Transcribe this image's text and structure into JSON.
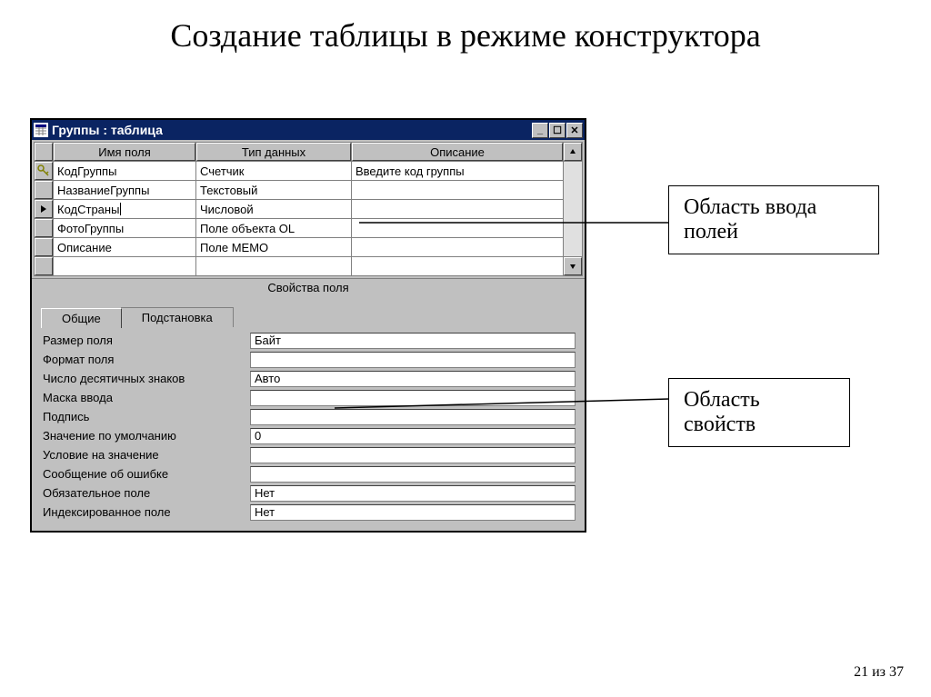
{
  "slide_title": "Создание таблицы в режиме конструктора",
  "window": {
    "title": "Группы : таблица",
    "columns": {
      "name": "Имя поля",
      "type": "Тип данных",
      "desc": "Описание"
    },
    "rows": [
      {
        "name": "КодГруппы",
        "type": "Счетчик",
        "desc": "Введите код группы",
        "icon": "key"
      },
      {
        "name": "НазваниеГруппы",
        "type": "Текстовый",
        "desc": "",
        "icon": ""
      },
      {
        "name": "КодСтраны",
        "type": "Числовой",
        "desc": "",
        "icon": "current"
      },
      {
        "name": "ФотоГруппы",
        "type": "Поле объекта OL",
        "desc": "",
        "icon": ""
      },
      {
        "name": "Описание",
        "type": "Поле МЕМО",
        "desc": "",
        "icon": ""
      }
    ],
    "propbar_label": "Свойства поля",
    "tabs": {
      "general": "Общие",
      "lookup": "Подстановка"
    },
    "properties": [
      {
        "label": "Размер поля",
        "value": "Байт"
      },
      {
        "label": "Формат поля",
        "value": ""
      },
      {
        "label": "Число десятичных знаков",
        "value": "Авто"
      },
      {
        "label": "Маска ввода",
        "value": ""
      },
      {
        "label": "Подпись",
        "value": ""
      },
      {
        "label": "Значение по умолчанию",
        "value": "0"
      },
      {
        "label": "Условие на значение",
        "value": ""
      },
      {
        "label": "Сообщение об ошибке",
        "value": ""
      },
      {
        "label": "Обязательное поле",
        "value": "Нет"
      },
      {
        "label": "Индексированное поле",
        "value": "Нет"
      }
    ]
  },
  "callouts": {
    "fields": "Область ввода полей",
    "props": "Область свойств"
  },
  "page": "21 из 37"
}
